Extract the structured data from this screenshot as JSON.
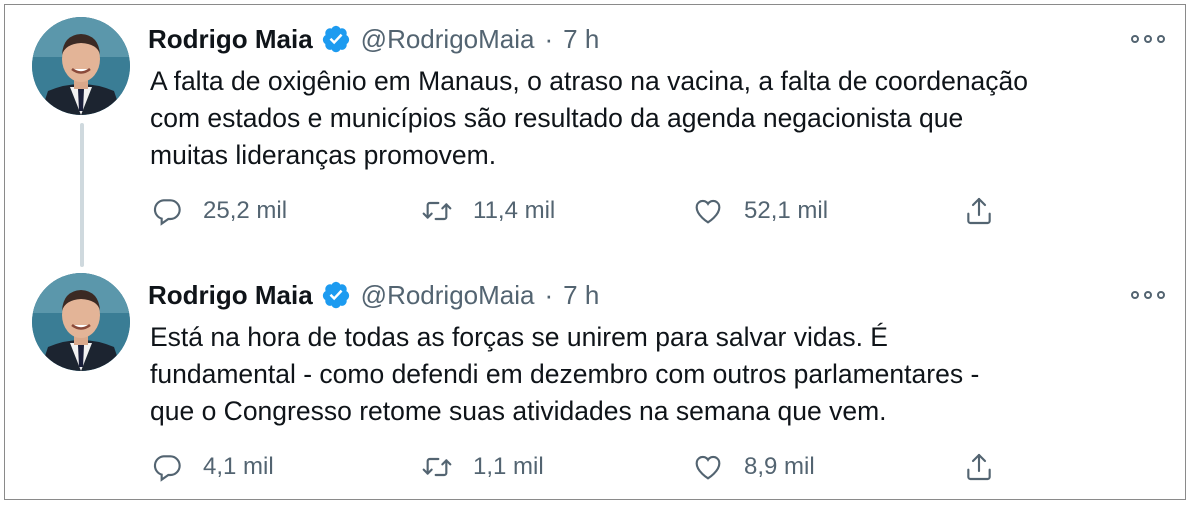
{
  "colors": {
    "verified": "#1d9bf0",
    "secondary_text": "#536471",
    "thread_line": "#cfd9de"
  },
  "tweets": [
    {
      "author_name": "Rodrigo Maia",
      "handle": "@RodrigoMaia",
      "separator": "·",
      "time": "7 h",
      "text_lines": [
        "A falta de oxigênio em Manaus, o atraso na vacina, a falta de coordenação",
        "com estados e municípios são resultado da agenda negacionista que",
        "muitas lideranças promovem."
      ],
      "replies": "25,2 mil",
      "retweets": "11,4 mil",
      "likes": "52,1 mil"
    },
    {
      "author_name": "Rodrigo Maia",
      "handle": "@RodrigoMaia",
      "separator": "·",
      "time": "7 h",
      "text_lines": [
        "Está na hora de todas as forças se unirem para salvar vidas. É",
        "fundamental - como defendi em dezembro com outros parlamentares -",
        "que o Congresso retome suas atividades na semana que vem."
      ],
      "replies": "4,1 mil",
      "retweets": "1,1 mil",
      "likes": "8,9 mil"
    }
  ]
}
